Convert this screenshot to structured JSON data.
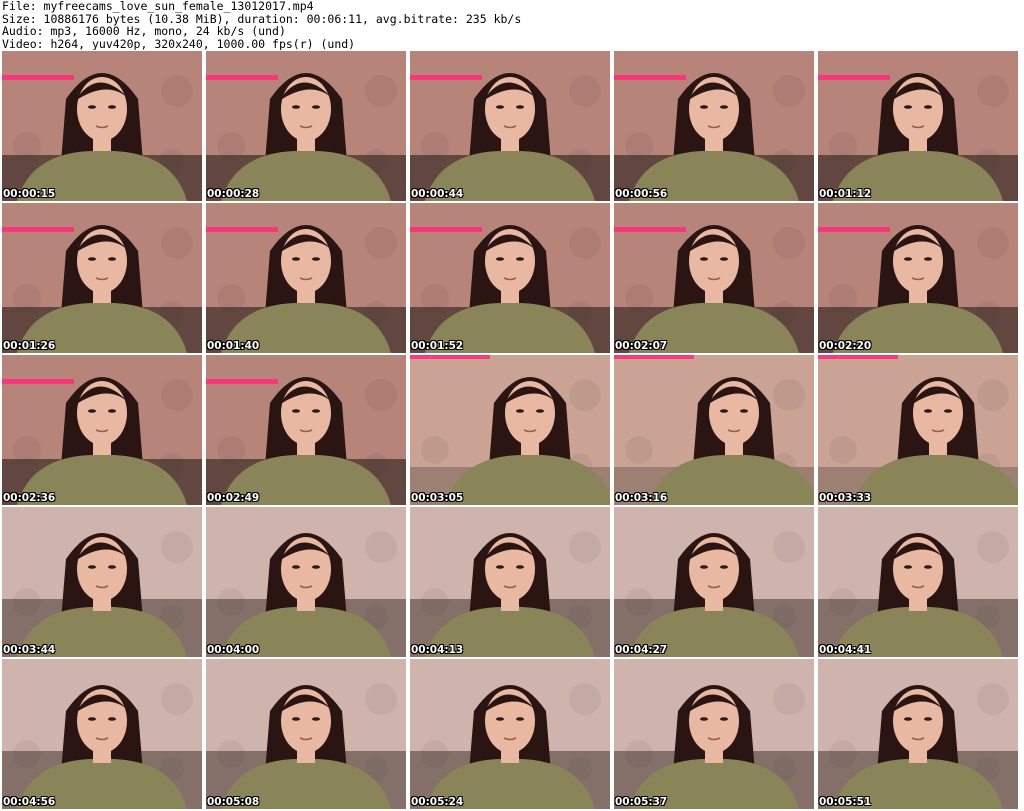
{
  "header": {
    "file_line": "File: myfreecams_love_sun_female_13012017.mp4",
    "size_line": "Size: 10886176 bytes (10.38 MiB), duration: 00:06:11, avg.bitrate: 235 kb/s",
    "audio_line": "Audio: mp3, 16000 Hz, mono, 24 kb/s (und)",
    "video_line": "Video: h264, yuv420p, 320x240, 1000.00 fps(r) (und)"
  },
  "thumbnails": [
    {
      "timestamp": "00:00:15",
      "scene": "a"
    },
    {
      "timestamp": "00:00:28",
      "scene": "a"
    },
    {
      "timestamp": "00:00:44",
      "scene": "a"
    },
    {
      "timestamp": "00:00:56",
      "scene": "a"
    },
    {
      "timestamp": "00:01:12",
      "scene": "a"
    },
    {
      "timestamp": "00:01:26",
      "scene": "a"
    },
    {
      "timestamp": "00:01:40",
      "scene": "a"
    },
    {
      "timestamp": "00:01:52",
      "scene": "a"
    },
    {
      "timestamp": "00:02:07",
      "scene": "a"
    },
    {
      "timestamp": "00:02:20",
      "scene": "a"
    },
    {
      "timestamp": "00:02:36",
      "scene": "a"
    },
    {
      "timestamp": "00:02:49",
      "scene": "a"
    },
    {
      "timestamp": "00:03:05",
      "scene": "b"
    },
    {
      "timestamp": "00:03:16",
      "scene": "b"
    },
    {
      "timestamp": "00:03:33",
      "scene": "b"
    },
    {
      "timestamp": "00:03:44",
      "scene": "c"
    },
    {
      "timestamp": "00:04:00",
      "scene": "c"
    },
    {
      "timestamp": "00:04:13",
      "scene": "c"
    },
    {
      "timestamp": "00:04:27",
      "scene": "c"
    },
    {
      "timestamp": "00:04:41",
      "scene": "c"
    },
    {
      "timestamp": "00:04:56",
      "scene": "c"
    },
    {
      "timestamp": "00:05:08",
      "scene": "c"
    },
    {
      "timestamp": "00:05:24",
      "scene": "c"
    },
    {
      "timestamp": "00:05:37",
      "scene": "c"
    },
    {
      "timestamp": "00:05:51",
      "scene": "c"
    }
  ],
  "colors": {
    "wall_a": "#b7847a",
    "wall_b": "#caa394",
    "wall_c": "#cfb4ad",
    "accent_pink": "#ff2f7a",
    "sweater": "#8a8558",
    "hair": "#2a1512",
    "skin": "#e8b8a2"
  }
}
